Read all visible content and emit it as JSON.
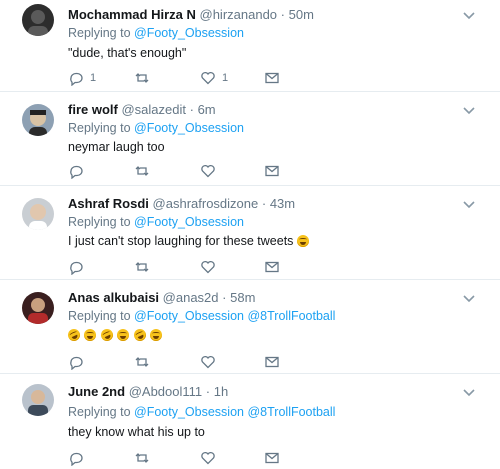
{
  "tweets": [
    {
      "name": "Mochammad Hirza N",
      "handle": "@hirzanando",
      "time": "50m",
      "replying_label": "Replying to",
      "mentions": [
        "@Footy_Obsession"
      ],
      "text": "\"dude, that's enough\"",
      "reply_count": "1",
      "retweet_count": "",
      "like_count": "1",
      "avatar_colors": [
        "#2d2d2d",
        "#5a5a5a"
      ]
    },
    {
      "name": "fire wolf",
      "handle": "@salazedit",
      "time": "6m",
      "replying_label": "Replying to",
      "mentions": [
        "@Footy_Obsession"
      ],
      "text": "neymar laugh too",
      "reply_count": "",
      "retweet_count": "",
      "like_count": "",
      "avatar_colors": [
        "#8da0b3",
        "#d8c3a5"
      ]
    },
    {
      "name": "Ashraf Rosdi",
      "handle": "@ashrafrosdizone",
      "time": "43m",
      "replying_label": "Replying to",
      "mentions": [
        "@Footy_Obsession"
      ],
      "text": "I just can't stop laughing for these tweets",
      "emoji_count": 1,
      "reply_count": "",
      "retweet_count": "",
      "like_count": "",
      "avatar_colors": [
        "#c9ced3",
        "#e1c7ae"
      ]
    },
    {
      "name": "Anas alkubaisi",
      "handle": "@anas2d",
      "time": "58m",
      "replying_label": "Replying to",
      "mentions": [
        "@Footy_Obsession",
        "@8TrollFootball"
      ],
      "text": "",
      "emoji_count": 6,
      "reply_count": "",
      "retweet_count": "",
      "like_count": "",
      "avatar_colors": [
        "#3a1f1f",
        "#b22b2b"
      ]
    },
    {
      "name": "June 2nd",
      "handle": "@Abdool111",
      "time": "1h",
      "replying_label": "Replying to",
      "mentions": [
        "@Footy_Obsession",
        "@8TrollFootball"
      ],
      "text": "they know what his up to",
      "reply_count": "",
      "retweet_count": "",
      "like_count": "",
      "avatar_colors": [
        "#b9c2cc",
        "#3c4a5a"
      ]
    }
  ],
  "colors": {
    "accent": "#1da1f2",
    "muted": "#657786",
    "text": "#14171a",
    "divider": "#e6ecf0"
  }
}
